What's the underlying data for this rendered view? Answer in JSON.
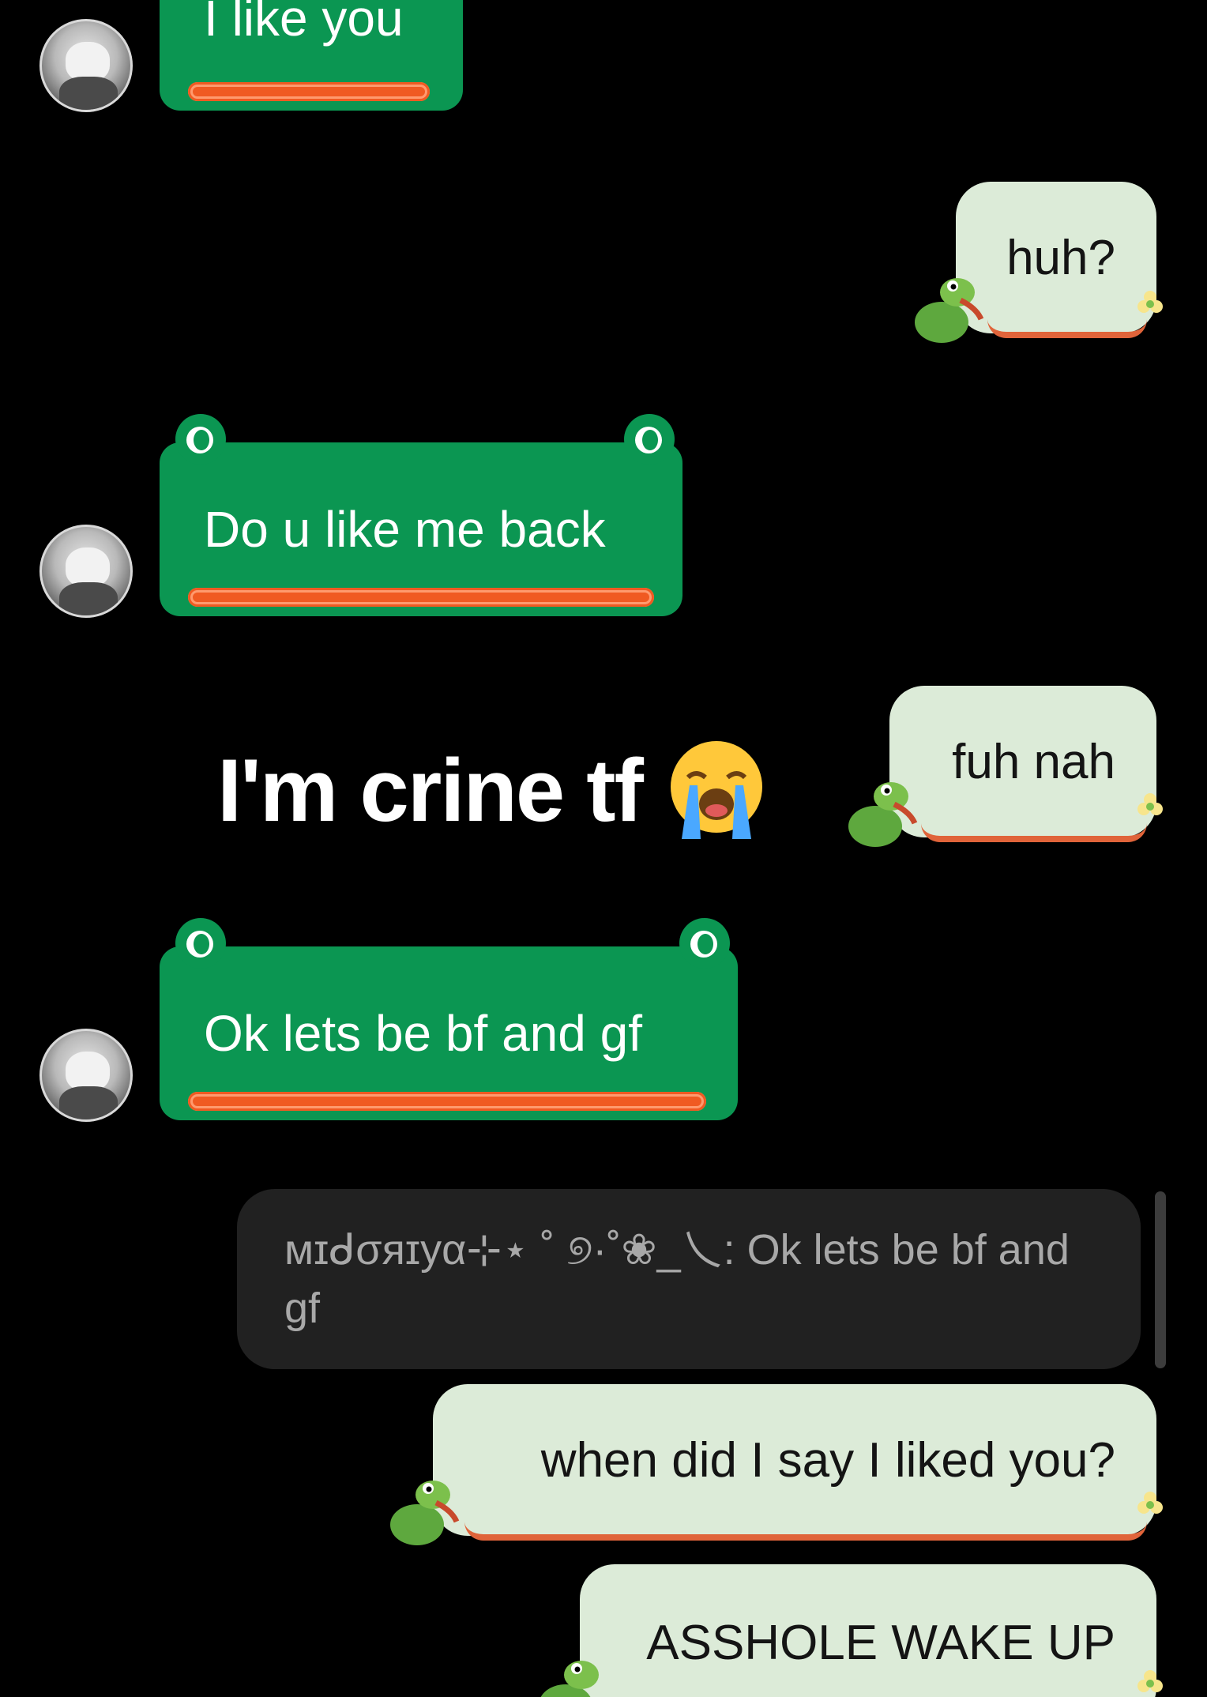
{
  "colors": {
    "background": "#000000",
    "incoming_bubble": "#0b9652",
    "outgoing_bubble": "#dcebd8",
    "accent_underline": "#f05a22",
    "reply_preview_bg": "#212121"
  },
  "messages": [
    {
      "direction": "incoming",
      "text": "I like you"
    },
    {
      "direction": "outgoing",
      "text": "huh?"
    },
    {
      "direction": "incoming",
      "text": "Do u like me back"
    },
    {
      "direction": "outgoing",
      "text": "fuh nah"
    },
    {
      "direction": "incoming",
      "text": "Ok lets be bf and gf"
    },
    {
      "direction": "outgoing",
      "text": "when did I say I liked you?"
    },
    {
      "direction": "outgoing",
      "text": "ASSHOLE WAKE UP"
    }
  ],
  "reply_preview": {
    "sender": "ᴍɪᑯσяɪуα⊹⋆ ˚ ୭·˚❀_乀:",
    "text": "Ok lets be bf and gf"
  },
  "overlay_caption": {
    "text": "I'm crine tf",
    "emoji": "loudly-crying-face-emoji"
  },
  "icons": {
    "avatar": "anime-character-avatar-icon",
    "frog_sticker": "frog-icon",
    "flower_sticker": "flower-icon"
  }
}
